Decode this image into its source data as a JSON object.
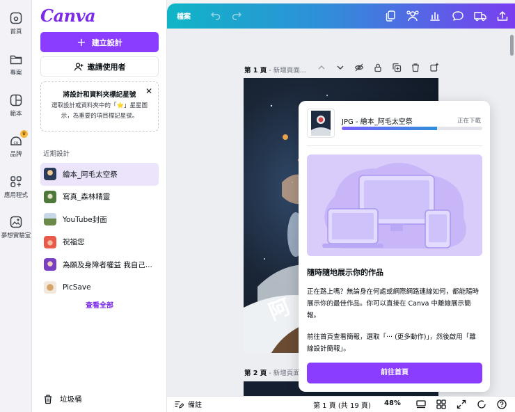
{
  "rail": {
    "items": [
      {
        "label": "首頁",
        "icon": "home-icon"
      },
      {
        "label": "專案",
        "icon": "folder-icon"
      },
      {
        "label": "範本",
        "icon": "template-icon"
      },
      {
        "label": "品牌",
        "icon": "brand-icon"
      },
      {
        "label": "應用程式",
        "icon": "apps-icon"
      },
      {
        "label": "夢想實驗室",
        "icon": "dream-lab-icon"
      }
    ]
  },
  "panel": {
    "logo": "Canva",
    "create_label": "建立設計",
    "invite_label": "邀請使用者",
    "tip": {
      "title": "將設計和資料夾標記星號",
      "body": "選取設計或資料夾中的「⭐」星星圖示，為重要的項目標記星號。",
      "close": "✕"
    },
    "recent_heading": "近期設計",
    "recent": [
      {
        "label": "繪本_阿毛太空祭",
        "color": "#2a3b5a"
      },
      {
        "label": "寫真_森林精靈",
        "color": "#4d7a3a"
      },
      {
        "label": "YouTube封面",
        "color": "#c9d8e8"
      },
      {
        "label": "祝福您",
        "color": "#e85a4a"
      },
      {
        "label": "為願及身障者權益 我自己...",
        "color": "#7a3ec0"
      },
      {
        "label": "PicSave",
        "color": "#d6a36a"
      }
    ],
    "see_all": "查看全部",
    "trash": "垃圾桶"
  },
  "topbar": {
    "file": "檔案",
    "icons": [
      "duplicate-icon",
      "share-people-icon",
      "analytics-icon",
      "comment-icon",
      "delivery-icon",
      "upload-icon"
    ]
  },
  "canvas": {
    "page1": {
      "label": "第 1 頁",
      "title": "新增頁面..."
    },
    "page2": {
      "label": "第 2 頁",
      "title": "新增頁面..."
    }
  },
  "download": {
    "file_name": "JPG - 繪本_阿毛太空祭",
    "status": "正在下載",
    "progress": 0.68,
    "title": "隨時隨地展示你的作品",
    "body": "正在路上嗎？無論身在何處或網際網路連線如何，都能隨時展示你的最佳作品。你可以直接在 Canva 中離線展示簡報。",
    "body2": "前往首頁查看簡報，選取「··· (更多動作)」，然後啟用「離線設計簡報」。",
    "button": "前往首頁"
  },
  "bottombar": {
    "notes": "備註",
    "page_info": "第 1 頁 (共 19 頁)",
    "zoom": "48%"
  },
  "colors": {
    "accent": "#8b3dff",
    "brand": "#7d2ae8"
  }
}
